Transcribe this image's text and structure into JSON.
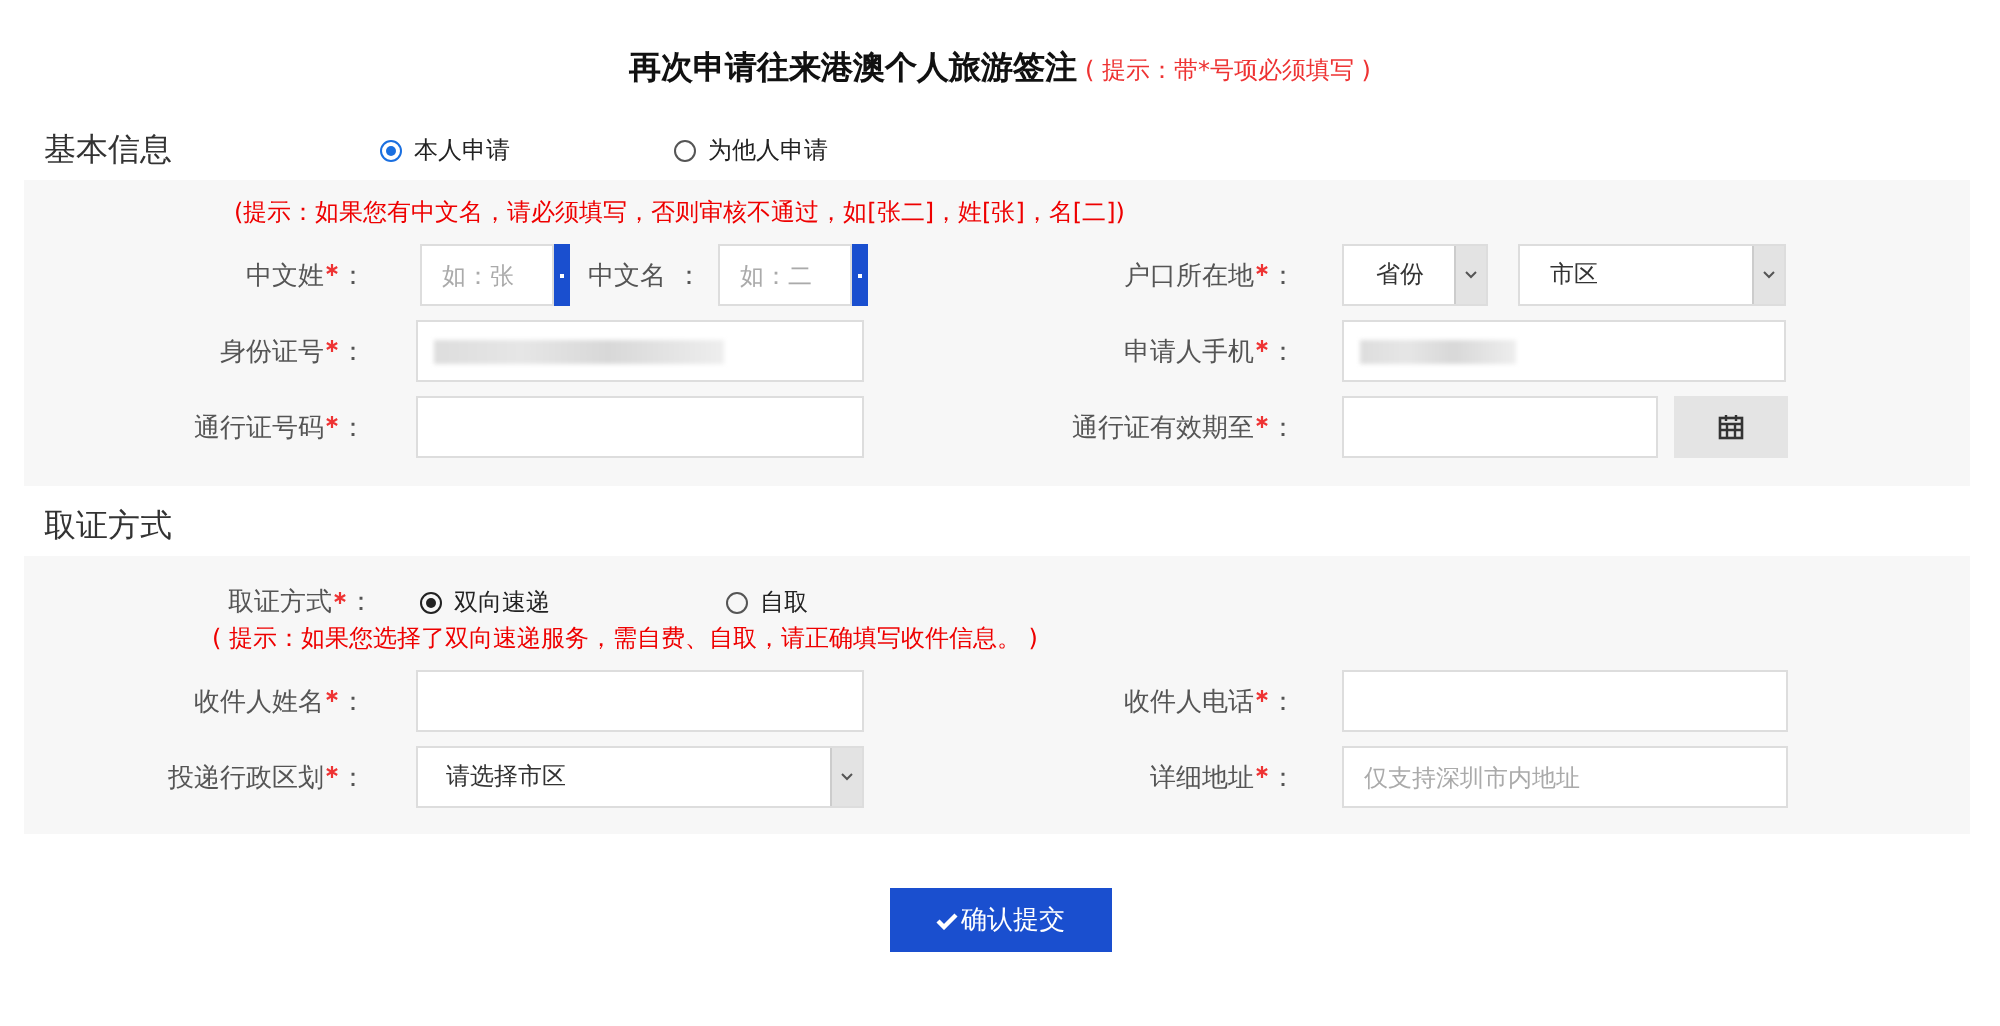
{
  "title": "再次申请往来港澳个人旅游签注",
  "title_hint": "( 提示：带*号项必须填写 )",
  "basic": {
    "heading": "基本信息",
    "options": [
      {
        "label": "本人申请",
        "selected": true
      },
      {
        "label": "为他人申请",
        "selected": false
      }
    ],
    "hint": "(提示：如果您有中文名，请必须填写，否则审核不通过，如[张二]，姓[张]，名[二])",
    "rows": [
      {
        "left": {
          "kind": "name_pair",
          "parts": [
            {
              "label": "中文姓",
              "required": true,
              "colon": "：",
              "placeholder": "如：张"
            },
            {
              "label": "中文名",
              "required": false,
              "colon": "：",
              "placeholder": "如：二"
            }
          ]
        },
        "right": {
          "kind": "select_pair",
          "label": "户口所在地",
          "required": true,
          "colon": "：",
          "options": [
            "省份",
            "市区"
          ]
        }
      },
      {
        "left": {
          "kind": "blurred",
          "label": "身份证号",
          "required": true,
          "colon": "："
        },
        "right": {
          "kind": "blurred",
          "label": "申请人手机",
          "required": true,
          "colon": "："
        }
      },
      {
        "left": {
          "kind": "text",
          "label": "通行证号码",
          "required": true,
          "colon": "："
        },
        "right": {
          "kind": "date",
          "label": "通行证有效期至",
          "required": true,
          "colon": "："
        }
      }
    ]
  },
  "collect": {
    "heading": "取证方式",
    "method_label": "取证方式",
    "method_required": true,
    "method_colon": "：",
    "options": [
      {
        "label": "双向速递",
        "selected": true
      },
      {
        "label": "自取",
        "selected": false
      }
    ],
    "hint": "( 提示：如果您选择了双向速递服务，需自费、自取，请正确填写收件信息。 )",
    "rows": [
      {
        "left": {
          "kind": "text",
          "label": "收件人姓名",
          "required": true,
          "colon": "："
        },
        "right": {
          "kind": "text",
          "label": "收件人电话",
          "required": true,
          "colon": "："
        }
      },
      {
        "left": {
          "kind": "select",
          "label": "投递行政区划",
          "required": true,
          "colon": "：",
          "value": "请选择市区"
        },
        "right": {
          "kind": "text",
          "label": "详细地址",
          "required": true,
          "colon": "：",
          "placeholder": "仅支持深圳市内地址"
        }
      }
    ]
  },
  "submit": "确认提交"
}
